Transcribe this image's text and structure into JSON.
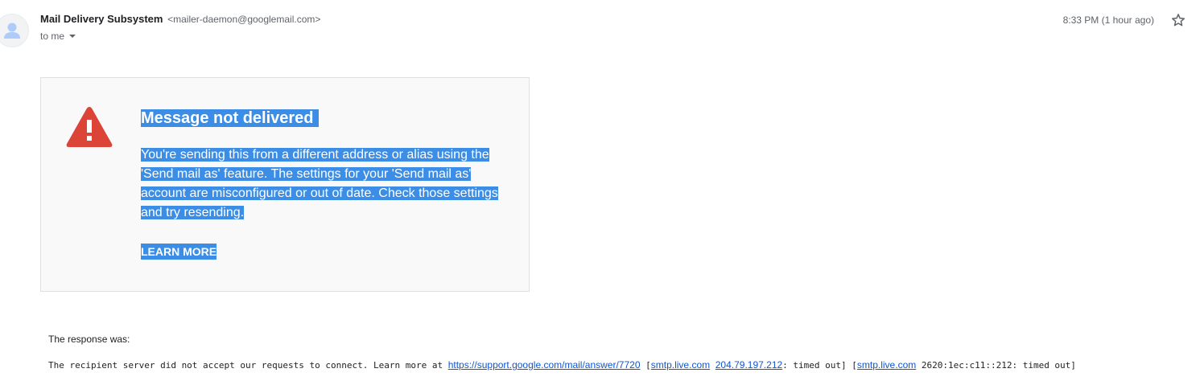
{
  "header": {
    "sender_name": "Mail Delivery Subsystem",
    "sender_email": "<mailer-daemon@googlemail.com>",
    "to_label": "to me",
    "timestamp": "8:33 PM (1 hour ago)",
    "icons": {
      "avatar": "person-avatar-icon",
      "expand": "caret-down-icon",
      "star": "star-outline-icon"
    }
  },
  "card": {
    "title": "Message not delivered",
    "body": "You're sending this from a different address or alias using the 'Send mail as' feature. The settings for your 'Send mail as' account are misconfigured or out of date. Check those settings and try resending.",
    "link_label": "LEARN MORE",
    "icon": "warning-triangle-icon"
  },
  "response": {
    "label": "The response was:",
    "text_before": "The recipient server did not accept our requests to connect. Learn more at ",
    "link_url_text": "https://support.google.com/mail/answer/7720",
    "bracket_open_1": " [",
    "host_1": "smtp.live.com",
    "space": " ",
    "ip_1": "204.79.197.212",
    "timeout_1": ": timed out] [",
    "host_2": "smtp.live.com",
    "ip_2_text": " 2620:1ec:c11::212: timed out]"
  },
  "colors": {
    "highlight": "#3b8de6",
    "warning_red": "#db4437",
    "link_blue": "#1155cc",
    "card_bg": "#f9f9f9"
  }
}
